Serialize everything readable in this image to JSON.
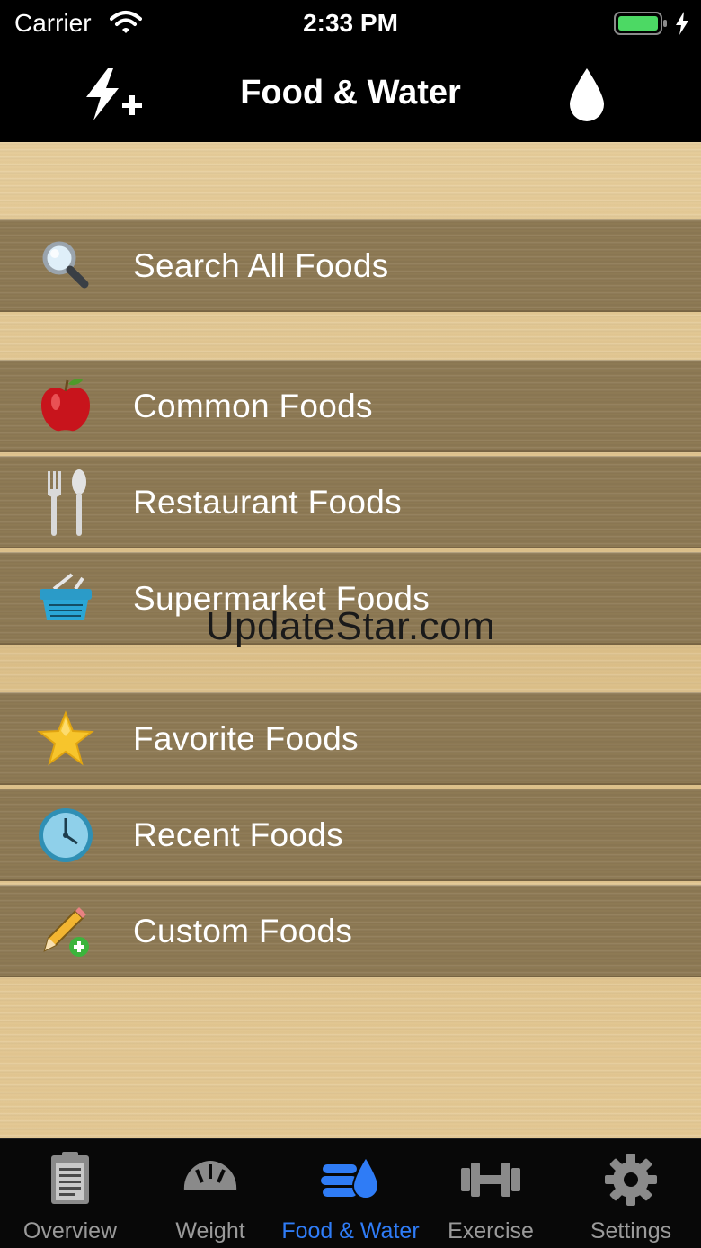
{
  "status_bar": {
    "carrier": "Carrier",
    "time": "2:33 PM"
  },
  "nav": {
    "title": "Food & Water",
    "left_icon": "quick-add-bolt-icon",
    "right_icon": "water-drop-icon"
  },
  "menu": {
    "search": {
      "label": "Search All Foods",
      "icon": "magnifier-icon"
    },
    "browse": [
      {
        "label": "Common Foods",
        "icon": "apple-icon"
      },
      {
        "label": "Restaurant Foods",
        "icon": "fork-spoon-icon"
      },
      {
        "label": "Supermarket Foods",
        "icon": "basket-icon"
      }
    ],
    "personal": [
      {
        "label": "Favorite Foods",
        "icon": "star-icon"
      },
      {
        "label": "Recent Foods",
        "icon": "clock-icon"
      },
      {
        "label": "Custom Foods",
        "icon": "pencil-add-icon"
      }
    ]
  },
  "watermark": "UpdateStar.com",
  "tabs": [
    {
      "label": "Overview",
      "icon": "clipboard-icon",
      "active": false
    },
    {
      "label": "Weight",
      "icon": "scale-icon",
      "active": false
    },
    {
      "label": "Food & Water",
      "icon": "food-water-icon",
      "active": true
    },
    {
      "label": "Exercise",
      "icon": "dumbbell-icon",
      "active": false
    },
    {
      "label": "Settings",
      "icon": "gear-icon",
      "active": false
    }
  ],
  "colors": {
    "active_tab": "#2f7cf6",
    "inactive_tab": "#9a9a9a",
    "row": "#8f7b56",
    "wood": "#e3c996"
  }
}
